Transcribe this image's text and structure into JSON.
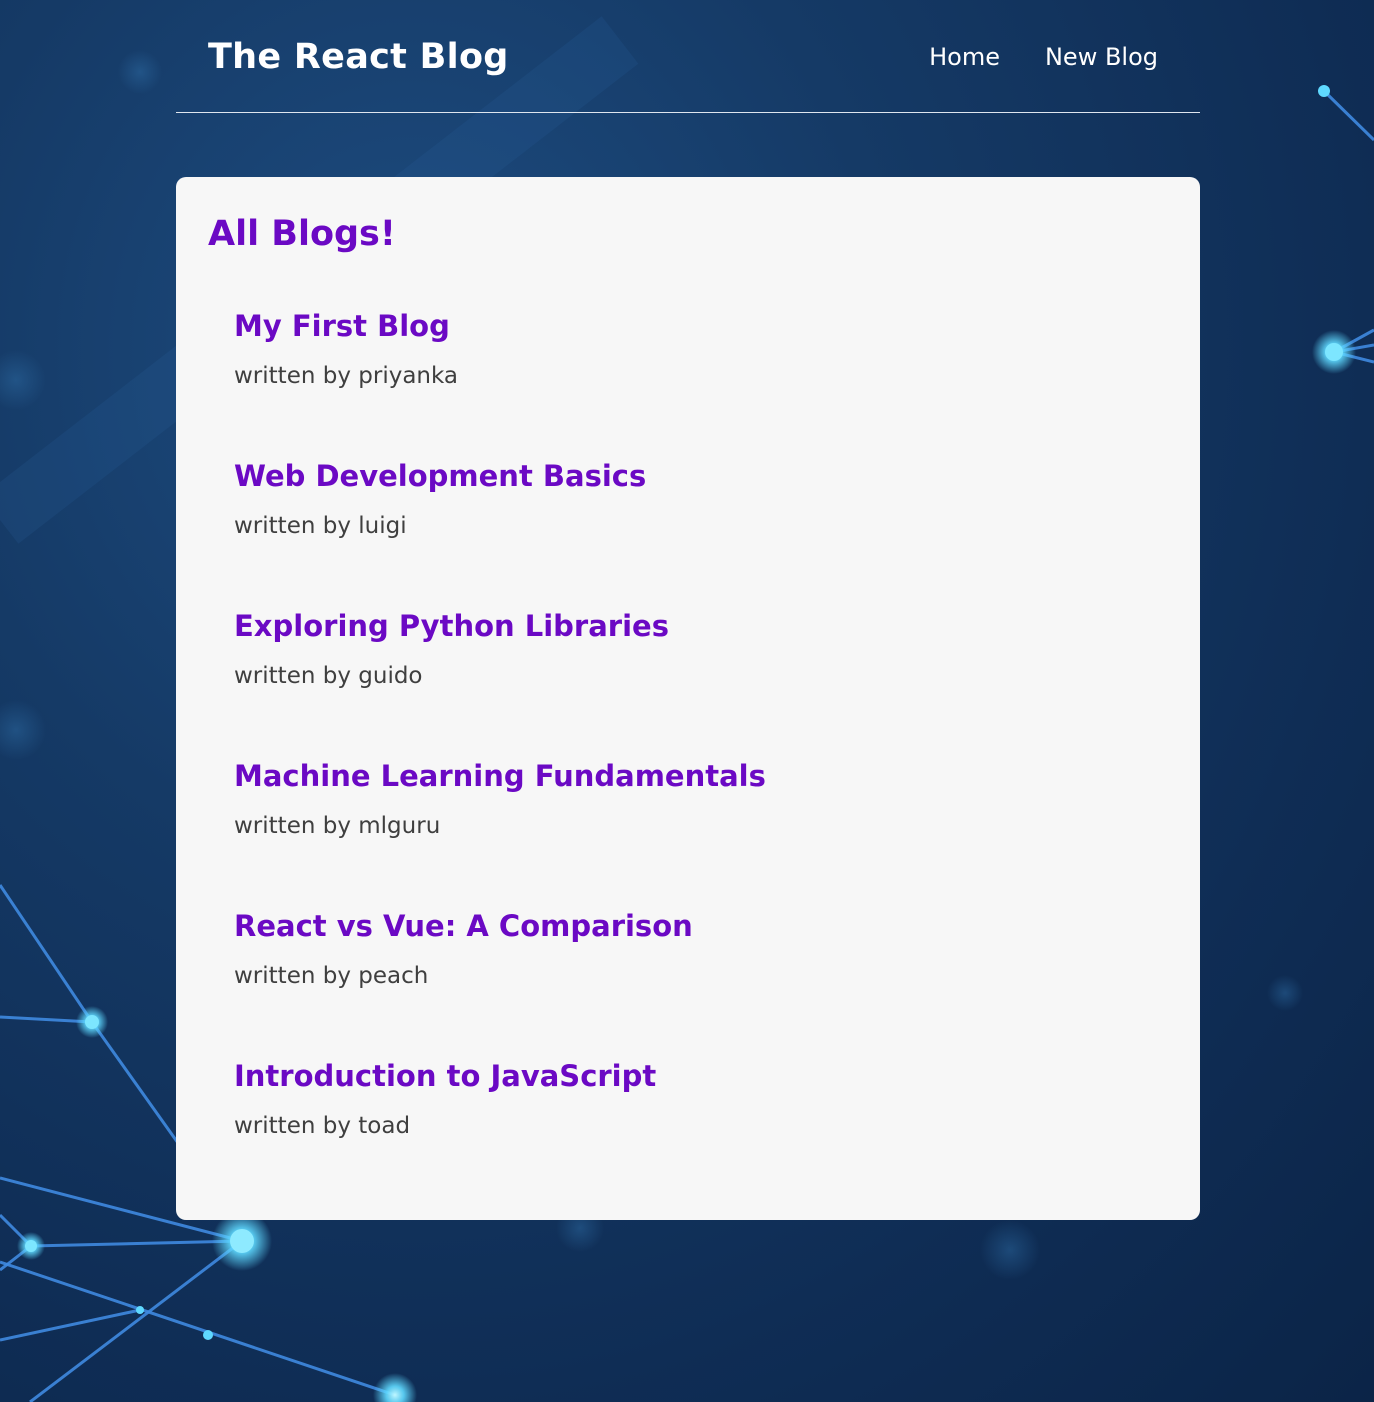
{
  "header": {
    "title": "The React Blog",
    "nav": [
      {
        "label": "Home"
      },
      {
        "label": "New Blog"
      }
    ]
  },
  "main": {
    "heading": "All Blogs!",
    "blogs": [
      {
        "title": "My First Blog",
        "byline_prefix": "written by",
        "author": "priyanka"
      },
      {
        "title": "Web Development Basics",
        "byline_prefix": "written by",
        "author": "luigi"
      },
      {
        "title": "Exploring Python Libraries",
        "byline_prefix": "written by",
        "author": "guido"
      },
      {
        "title": "Machine Learning Fundamentals",
        "byline_prefix": "written by",
        "author": "mlguru"
      },
      {
        "title": "React vs Vue: A Comparison",
        "byline_prefix": "written by",
        "author": "peach"
      },
      {
        "title": "Introduction to JavaScript",
        "byline_prefix": "written by",
        "author": "toad"
      }
    ]
  },
  "colors": {
    "background": "#153a66",
    "accent": "#6b09c4",
    "card": "#f7f7f7",
    "text_muted": "#3f3f3f",
    "network_line": "#3f8ae0",
    "network_node": "#5fd9ff"
  }
}
